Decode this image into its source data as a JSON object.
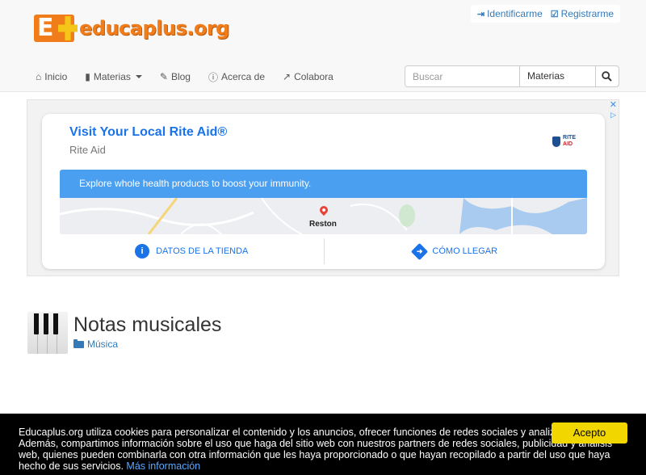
{
  "header": {
    "logo_text": "educaplus.org",
    "user_links": {
      "login": "Identificarme",
      "register": "Registrarme"
    },
    "nav": {
      "home": "Inicio",
      "subjects": "Materias",
      "blog": "Blog",
      "about": "Acerca de",
      "contribute": "Colabora"
    },
    "search": {
      "placeholder": "Buscar",
      "category": "Materias"
    }
  },
  "ad": {
    "title": "Visit Your Local Rite Aid®",
    "subtitle": "Rite Aid",
    "logo_line1": "RITE",
    "logo_line2": "AID",
    "banner": "Explore whole health products to boost your immunity.",
    "map_label": "Reston",
    "action_store": "DATOS DE LA TIENDA",
    "action_directions": "CÓMO LLEGAR"
  },
  "content": {
    "title": "Notas musicales",
    "category": "Música"
  },
  "cookie": {
    "text": "Educaplus.org utiliza cookies para personalizar el contenido y los anuncios, ofrecer funciones de redes sociales y analizar el tráfico. Además, compartimos información sobre el uso que haga del sitio web con nuestros partners de redes sociales, publicidad y análisis web, quienes pueden combinarla con otra información que les haya proporcionado o que hayan recopilado a partir del uso que haya hecho de sus servicios.",
    "more_link": "Más información",
    "accept": "Acepto"
  },
  "colors": {
    "link": "#337ab7",
    "ad_blue": "#1a73e8",
    "banner_blue": "#4a9ff0",
    "logo_orange": "#f07d1a",
    "cookie_button": "#f1d600"
  }
}
